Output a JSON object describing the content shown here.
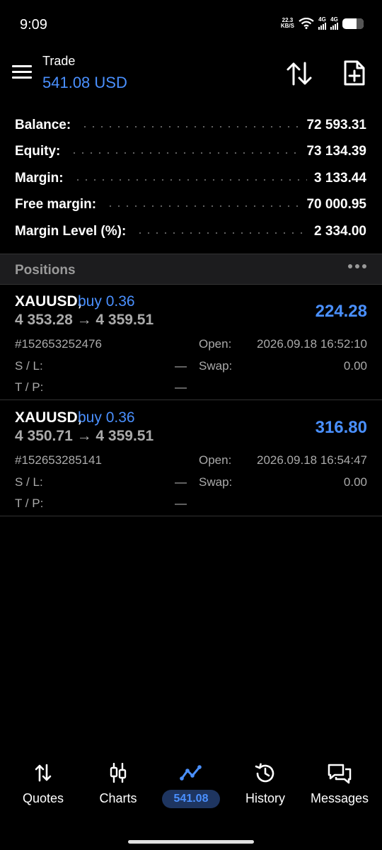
{
  "status_bar": {
    "time": "9:09",
    "speed_value": "22.3",
    "speed_unit": "KB/S",
    "net1": "4G",
    "net2": "4G"
  },
  "header": {
    "title": "Trade",
    "subtitle": "541.08 USD"
  },
  "account": [
    {
      "label": "Balance:",
      "value": "72 593.31"
    },
    {
      "label": "Equity:",
      "value": "73 134.39"
    },
    {
      "label": "Margin:",
      "value": "3 133.44"
    },
    {
      "label": "Free margin:",
      "value": "70 000.95"
    },
    {
      "label": "Margin Level (%):",
      "value": "2 334.00"
    }
  ],
  "positions_title": "Positions",
  "positions": [
    {
      "symbol": "XAUUSD,",
      "side": "buy 0.36",
      "prices": "4 353.28 → 4 359.51",
      "profit": "224.28",
      "ticket": "#152653252476",
      "open_label": "Open:",
      "open_time": "2026.09.18 16:52:10",
      "sl_label": "S / L:",
      "sl_value": "—",
      "swap_label": "Swap:",
      "swap_value": "0.00",
      "tp_label": "T / P:",
      "tp_value": "—"
    },
    {
      "symbol": "XAUUSD,",
      "side": "buy 0.36",
      "prices": "4 350.71 → 4 359.51",
      "profit": "316.80",
      "ticket": "#152653285141",
      "open_label": "Open:",
      "open_time": "2026.09.18 16:54:47",
      "sl_label": "S / L:",
      "sl_value": "—",
      "swap_label": "Swap:",
      "swap_value": "0.00",
      "tp_label": "T / P:",
      "tp_value": "—"
    }
  ],
  "bottom_nav": [
    {
      "label": "Quotes",
      "icon": "quotes-arrows-icon"
    },
    {
      "label": "Charts",
      "icon": "candlestick-icon"
    },
    {
      "label": "541.08",
      "icon": "trade-line-icon",
      "active": true
    },
    {
      "label": "History",
      "icon": "history-clock-icon"
    },
    {
      "label": "Messages",
      "icon": "messages-icon"
    }
  ],
  "colors": {
    "accent": "#4a90ff",
    "background": "#000000",
    "muted_text": "#aaaaaa"
  }
}
